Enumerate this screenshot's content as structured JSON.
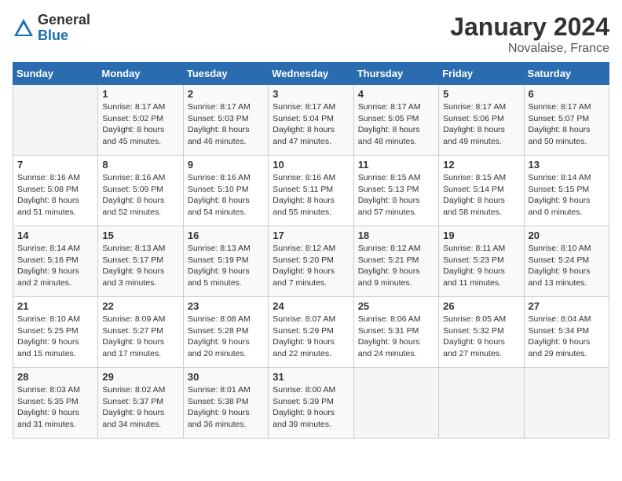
{
  "header": {
    "logo_general": "General",
    "logo_blue": "Blue",
    "month_title": "January 2024",
    "location": "Novalaise, France"
  },
  "days_of_week": [
    "Sunday",
    "Monday",
    "Tuesday",
    "Wednesday",
    "Thursday",
    "Friday",
    "Saturday"
  ],
  "weeks": [
    [
      {
        "day": "",
        "info": ""
      },
      {
        "day": "1",
        "info": "Sunrise: 8:17 AM\nSunset: 5:02 PM\nDaylight: 8 hours\nand 45 minutes."
      },
      {
        "day": "2",
        "info": "Sunrise: 8:17 AM\nSunset: 5:03 PM\nDaylight: 8 hours\nand 46 minutes."
      },
      {
        "day": "3",
        "info": "Sunrise: 8:17 AM\nSunset: 5:04 PM\nDaylight: 8 hours\nand 47 minutes."
      },
      {
        "day": "4",
        "info": "Sunrise: 8:17 AM\nSunset: 5:05 PM\nDaylight: 8 hours\nand 48 minutes."
      },
      {
        "day": "5",
        "info": "Sunrise: 8:17 AM\nSunset: 5:06 PM\nDaylight: 8 hours\nand 49 minutes."
      },
      {
        "day": "6",
        "info": "Sunrise: 8:17 AM\nSunset: 5:07 PM\nDaylight: 8 hours\nand 50 minutes."
      }
    ],
    [
      {
        "day": "7",
        "info": "Sunrise: 8:16 AM\nSunset: 5:08 PM\nDaylight: 8 hours\nand 51 minutes."
      },
      {
        "day": "8",
        "info": "Sunrise: 8:16 AM\nSunset: 5:09 PM\nDaylight: 8 hours\nand 52 minutes."
      },
      {
        "day": "9",
        "info": "Sunrise: 8:16 AM\nSunset: 5:10 PM\nDaylight: 8 hours\nand 54 minutes."
      },
      {
        "day": "10",
        "info": "Sunrise: 8:16 AM\nSunset: 5:11 PM\nDaylight: 8 hours\nand 55 minutes."
      },
      {
        "day": "11",
        "info": "Sunrise: 8:15 AM\nSunset: 5:13 PM\nDaylight: 8 hours\nand 57 minutes."
      },
      {
        "day": "12",
        "info": "Sunrise: 8:15 AM\nSunset: 5:14 PM\nDaylight: 8 hours\nand 58 minutes."
      },
      {
        "day": "13",
        "info": "Sunrise: 8:14 AM\nSunset: 5:15 PM\nDaylight: 9 hours\nand 0 minutes."
      }
    ],
    [
      {
        "day": "14",
        "info": "Sunrise: 8:14 AM\nSunset: 5:16 PM\nDaylight: 9 hours\nand 2 minutes."
      },
      {
        "day": "15",
        "info": "Sunrise: 8:13 AM\nSunset: 5:17 PM\nDaylight: 9 hours\nand 3 minutes."
      },
      {
        "day": "16",
        "info": "Sunrise: 8:13 AM\nSunset: 5:19 PM\nDaylight: 9 hours\nand 5 minutes."
      },
      {
        "day": "17",
        "info": "Sunrise: 8:12 AM\nSunset: 5:20 PM\nDaylight: 9 hours\nand 7 minutes."
      },
      {
        "day": "18",
        "info": "Sunrise: 8:12 AM\nSunset: 5:21 PM\nDaylight: 9 hours\nand 9 minutes."
      },
      {
        "day": "19",
        "info": "Sunrise: 8:11 AM\nSunset: 5:23 PM\nDaylight: 9 hours\nand 11 minutes."
      },
      {
        "day": "20",
        "info": "Sunrise: 8:10 AM\nSunset: 5:24 PM\nDaylight: 9 hours\nand 13 minutes."
      }
    ],
    [
      {
        "day": "21",
        "info": "Sunrise: 8:10 AM\nSunset: 5:25 PM\nDaylight: 9 hours\nand 15 minutes."
      },
      {
        "day": "22",
        "info": "Sunrise: 8:09 AM\nSunset: 5:27 PM\nDaylight: 9 hours\nand 17 minutes."
      },
      {
        "day": "23",
        "info": "Sunrise: 8:08 AM\nSunset: 5:28 PM\nDaylight: 9 hours\nand 20 minutes."
      },
      {
        "day": "24",
        "info": "Sunrise: 8:07 AM\nSunset: 5:29 PM\nDaylight: 9 hours\nand 22 minutes."
      },
      {
        "day": "25",
        "info": "Sunrise: 8:06 AM\nSunset: 5:31 PM\nDaylight: 9 hours\nand 24 minutes."
      },
      {
        "day": "26",
        "info": "Sunrise: 8:05 AM\nSunset: 5:32 PM\nDaylight: 9 hours\nand 27 minutes."
      },
      {
        "day": "27",
        "info": "Sunrise: 8:04 AM\nSunset: 5:34 PM\nDaylight: 9 hours\nand 29 minutes."
      }
    ],
    [
      {
        "day": "28",
        "info": "Sunrise: 8:03 AM\nSunset: 5:35 PM\nDaylight: 9 hours\nand 31 minutes."
      },
      {
        "day": "29",
        "info": "Sunrise: 8:02 AM\nSunset: 5:37 PM\nDaylight: 9 hours\nand 34 minutes."
      },
      {
        "day": "30",
        "info": "Sunrise: 8:01 AM\nSunset: 5:38 PM\nDaylight: 9 hours\nand 36 minutes."
      },
      {
        "day": "31",
        "info": "Sunrise: 8:00 AM\nSunset: 5:39 PM\nDaylight: 9 hours\nand 39 minutes."
      },
      {
        "day": "",
        "info": ""
      },
      {
        "day": "",
        "info": ""
      },
      {
        "day": "",
        "info": ""
      }
    ]
  ]
}
